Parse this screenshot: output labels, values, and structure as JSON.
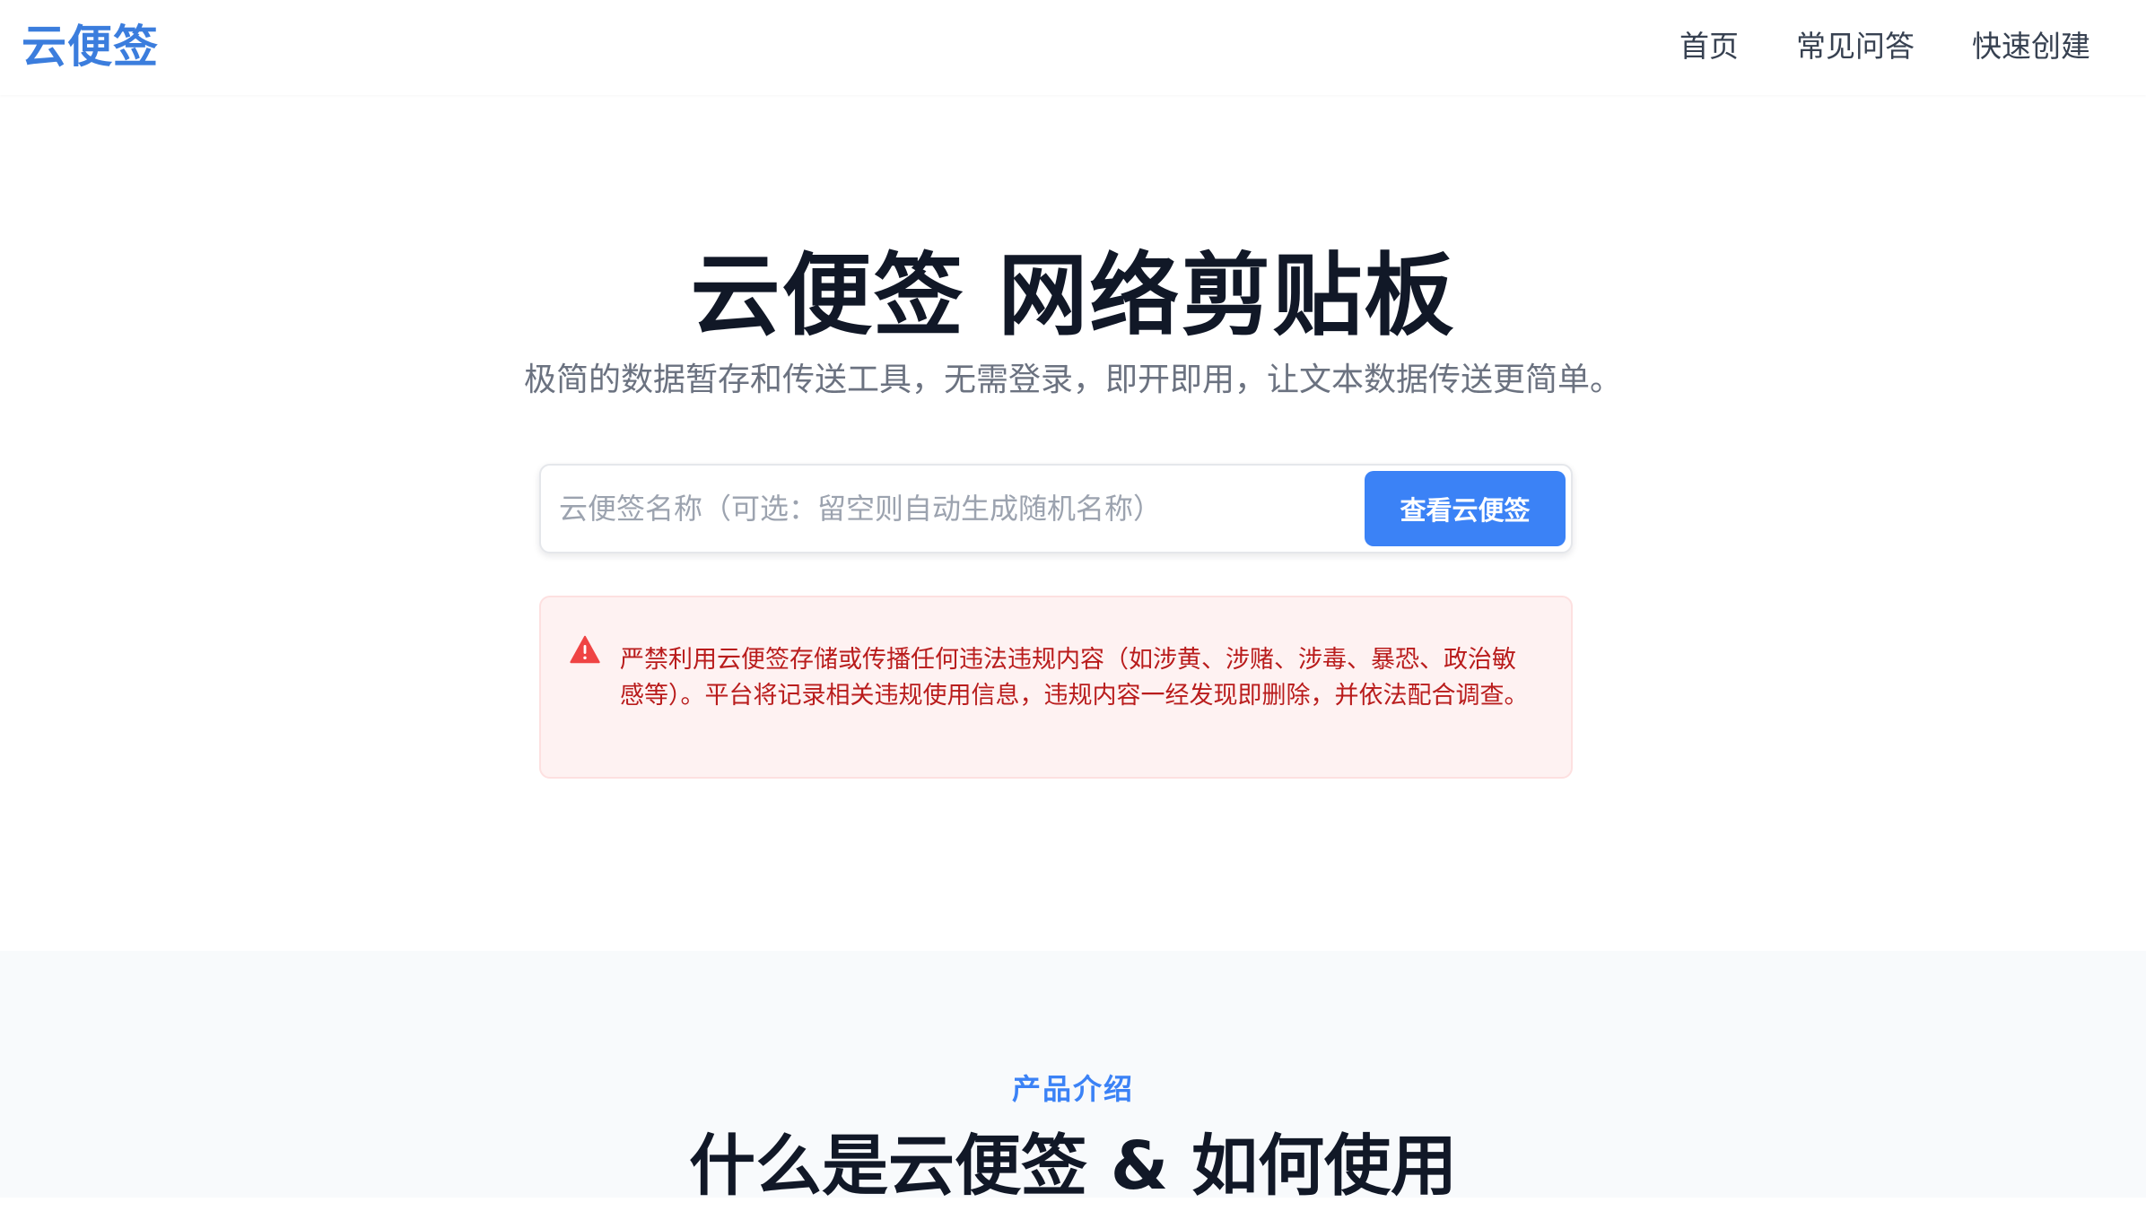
{
  "header": {
    "logo": "云便签",
    "nav": {
      "home": "首页",
      "faq": "常见问答",
      "quick_create": "快速创建"
    }
  },
  "hero": {
    "title": "云便签 网络剪贴板",
    "subtitle": "极简的数据暂存和传送工具，无需登录，即开即用，让文本数据传送更简单。"
  },
  "search": {
    "value": "",
    "placeholder": "云便签名称（可选：留空则自动生成随机名称）",
    "button_label": "查看云便签"
  },
  "warning": {
    "icon": "warning-triangle-icon",
    "text": "严禁利用云便签存储或传播任何违法违规内容（如涉黄、涉赌、涉毒、暴恐、政治敏感等）。平台将记录相关违规使用信息，违规内容一经发现即删除，并依法配合调查。"
  },
  "intro": {
    "eyebrow": "产品介绍",
    "title": "什么是云便签 & 如何使用"
  },
  "colors": {
    "brand": "#3b7ddd",
    "primary_button": "#3b82f6",
    "warning_bg": "#fef2f2",
    "warning_text": "#b91c1c",
    "warning_icon": "#ef4444"
  }
}
